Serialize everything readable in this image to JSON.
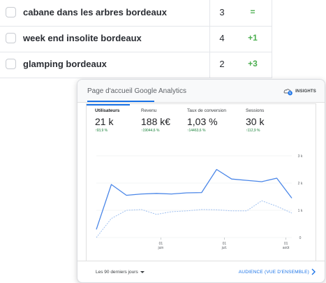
{
  "keywords": [
    {
      "keyword": "cabane dans les arbres bordeaux",
      "position": "3",
      "change": "="
    },
    {
      "keyword": "week end insolite bordeaux",
      "position": "4",
      "change": "+1"
    },
    {
      "keyword": "glamping bordeaux",
      "position": "2",
      "change": "+3"
    }
  ],
  "ga": {
    "title": "Page d'accueil Google Analytics",
    "insights_label": "INSIGHTS",
    "insights_badge": "5",
    "metrics": [
      {
        "label": "Utilisateurs",
        "value": "21 k",
        "change": "↑93,9 %"
      },
      {
        "label": "Revenu",
        "value": "188 k€",
        "change": "↑19044,6 %"
      },
      {
        "label": "Taux de conversion",
        "value": "1,03 %",
        "change": "↑14463,6 %"
      },
      {
        "label": "Sessions",
        "value": "30 k",
        "change": "↑112,9 %"
      }
    ],
    "period_label": "Les 90 derniers jours",
    "audience_link": "AUDIENCE (VUE D'ENSEMBLE)"
  },
  "colors": {
    "accent": "#1a73e8",
    "positive": "#4caf50",
    "series_current": "#4a86e8",
    "series_previous": "#9fc0f0"
  },
  "chart_data": {
    "type": "line",
    "y_ticks": [
      "3 k",
      "2 k",
      "1 k",
      "0"
    ],
    "ylim": [
      0,
      3000
    ],
    "x_tick_labels": [
      {
        "day": "01",
        "month": "juin"
      },
      {
        "day": "01",
        "month": "juil."
      },
      {
        "day": "01",
        "month": "août"
      }
    ],
    "series": [
      {
        "values": [
          300,
          1950,
          1550,
          1600,
          1620,
          1600,
          1640,
          1650,
          2500,
          2150,
          2100,
          2050,
          2180,
          1450
        ]
      },
      {
        "values": [
          0,
          700,
          1000,
          1030,
          850,
          950,
          980,
          1030,
          1020,
          980,
          980,
          1350,
          1150,
          900
        ]
      }
    ]
  }
}
